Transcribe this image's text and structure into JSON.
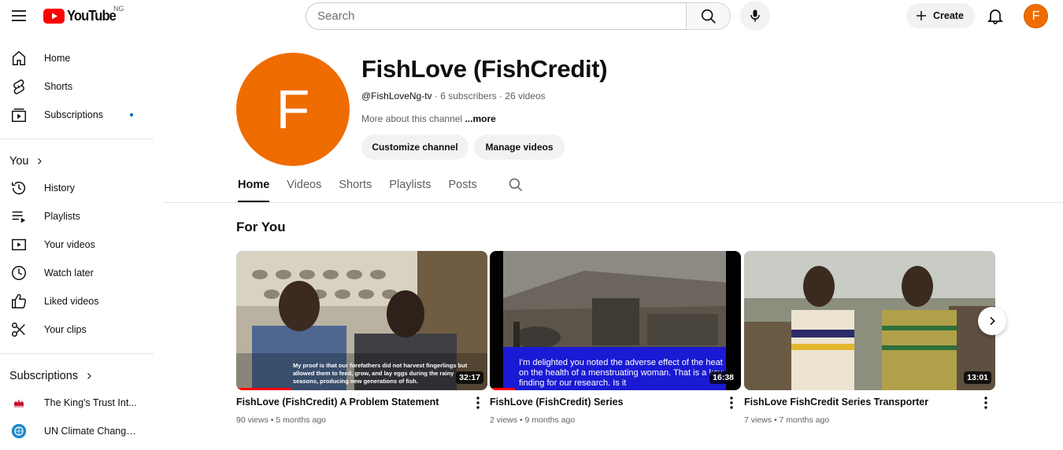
{
  "header": {
    "logo_text": "YouTube",
    "country_code": "NG",
    "search_placeholder": "Search",
    "create_label": "Create",
    "avatar_letter": "F",
    "brand_color": "#ff0000",
    "avatar_color": "#ef6c00"
  },
  "sidebar": {
    "main": [
      {
        "label": "Home",
        "icon": "home-icon"
      },
      {
        "label": "Shorts",
        "icon": "shorts-icon"
      },
      {
        "label": "Subscriptions",
        "icon": "subscriptions-icon"
      }
    ],
    "you_heading": "You",
    "you_items": [
      {
        "label": "History",
        "icon": "history-icon"
      },
      {
        "label": "Playlists",
        "icon": "playlists-icon"
      },
      {
        "label": "Your videos",
        "icon": "your-videos-icon"
      },
      {
        "label": "Watch later",
        "icon": "watch-later-icon"
      },
      {
        "label": "Liked videos",
        "icon": "thumbs-up-icon"
      },
      {
        "label": "Your clips",
        "icon": "scissors-icon"
      }
    ],
    "subs_heading": "Subscriptions",
    "subs_items": [
      {
        "label": "The King's Trust Int..."
      },
      {
        "label": "UN Climate Change..."
      }
    ]
  },
  "channel": {
    "avatar_letter": "F",
    "name": "FishLove (FishCredit)",
    "handle": "@FishLoveNg-tv",
    "subscribers": "6 subscribers",
    "videos_count": "26 videos",
    "separator": " · ",
    "about": "More about this channel",
    "more": "...more",
    "customize_label": "Customize channel",
    "manage_label": "Manage videos"
  },
  "tabs": [
    "Home",
    "Videos",
    "Shorts",
    "Playlists",
    "Posts"
  ],
  "active_tab": "Home",
  "section": {
    "title": "For You",
    "videos": [
      {
        "title": "FishLove (FishCredit) A Problem Statement",
        "views": "90 views",
        "age": "5 months ago",
        "duration": "32:17",
        "caption": "My proof is that our forefathers did not harvest fingerlings but allowed them to feed, grow, and lay eggs during the rainy seasons, producing new generations of fish.",
        "progress": 0.22
      },
      {
        "title": "FishLove (FishCredit) Series",
        "views": "2 views",
        "age": "9 months ago",
        "duration": "16:38",
        "caption": "I'm delighted you noted the adverse effect of the heat on the health of a menstruating woman. That is a key finding for our research. Is it",
        "progress": 0.1
      },
      {
        "title": "FishLove FishCredit Series Transporter",
        "views": "7 views",
        "age": "7 months ago",
        "duration": "13:01"
      }
    ]
  }
}
